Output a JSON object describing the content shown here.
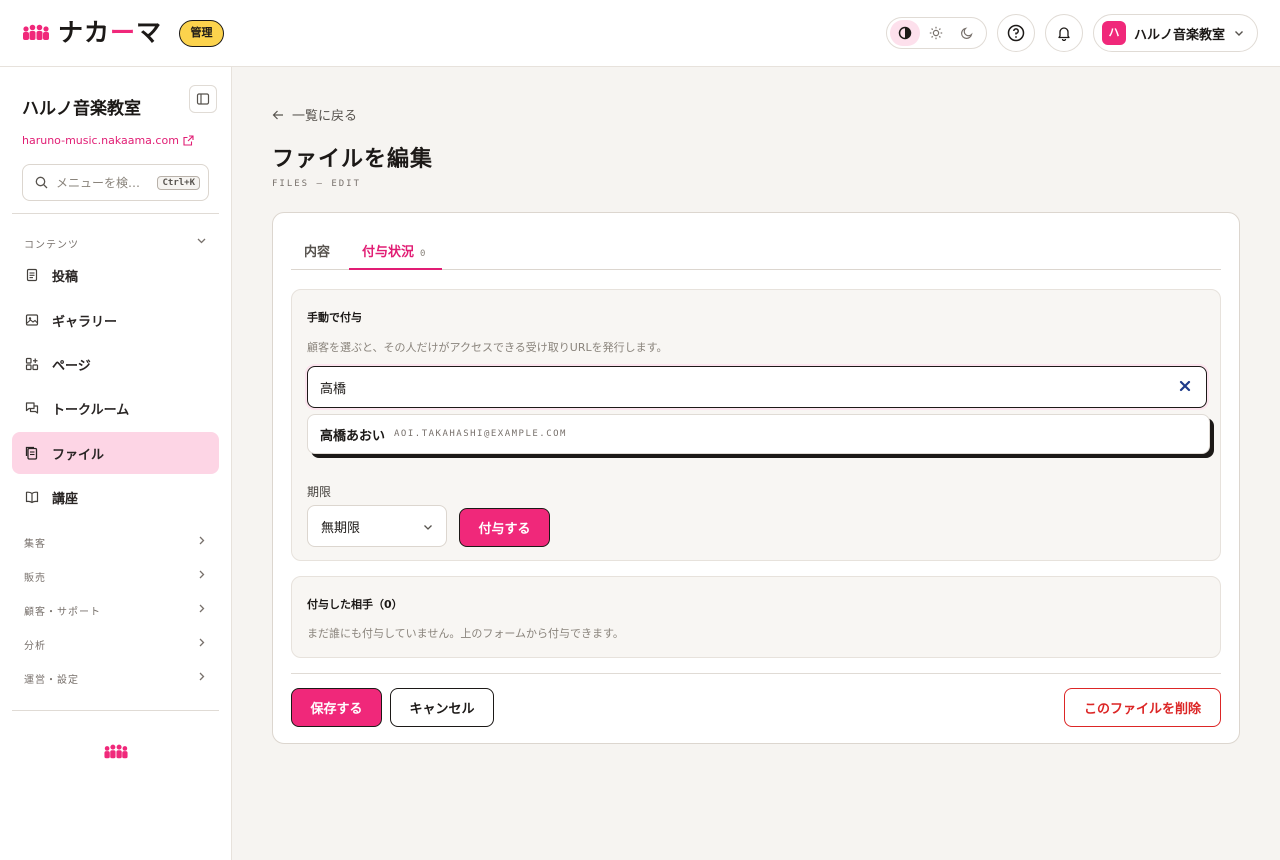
{
  "header": {
    "logo_text_1": "ナカ",
    "logo_text_accent": "ー",
    "logo_text_2": "マ",
    "admin_badge": "管理",
    "account_initial": "ハ",
    "account_name": "ハルノ音楽教室",
    "icons": [
      "contrast-icon",
      "sun-icon",
      "moon-icon",
      "help-icon",
      "bell-icon",
      "chevron-down-icon"
    ]
  },
  "sidebar": {
    "title": "ハルノ音楽教室",
    "site_url": "haruno-music.nakaama.com",
    "search_placeholder": "メニューを検…",
    "search_shortcut": "Ctrl+K",
    "content_group": "コンテンツ",
    "items": [
      {
        "label": "投稿",
        "icon": "document-icon"
      },
      {
        "label": "ギャラリー",
        "icon": "image-icon"
      },
      {
        "label": "ページ",
        "icon": "pages-icon"
      },
      {
        "label": "トークルーム",
        "icon": "chat-icon"
      },
      {
        "label": "ファイル",
        "icon": "file-icon"
      },
      {
        "label": "講座",
        "icon": "book-icon"
      }
    ],
    "groups": [
      "集客",
      "販売",
      "顧客・サポート",
      "分析",
      "運営・設定"
    ]
  },
  "main": {
    "back_label": "一覧に戻る",
    "title": "ファイルを編集",
    "subtitle": "FILES — EDIT",
    "tabs": [
      {
        "label": "内容"
      },
      {
        "label": "付与状況",
        "count": "0"
      }
    ],
    "manual": {
      "title": "手動で付与",
      "description": "顧客を選ぶと、その人だけがアクセスできる受け取りURLを発行します。",
      "search_value": "高橋",
      "result_name": "高橋あおい",
      "result_email": "AOI.TAKAHASHI@EXAMPLE.COM",
      "expiry_label": "期限",
      "expiry_value": "無期限",
      "grant_button": "付与する"
    },
    "granted": {
      "title": "付与した相手（0）",
      "empty_text": "まだ誰にも付与していません。上のフォームから付与できます。"
    },
    "save_button": "保存する",
    "cancel_button": "キャンセル",
    "delete_button": "このファイルを削除"
  },
  "colors": {
    "accent": "#f0287a",
    "badge": "#fcd34d",
    "danger": "#dc2626"
  }
}
